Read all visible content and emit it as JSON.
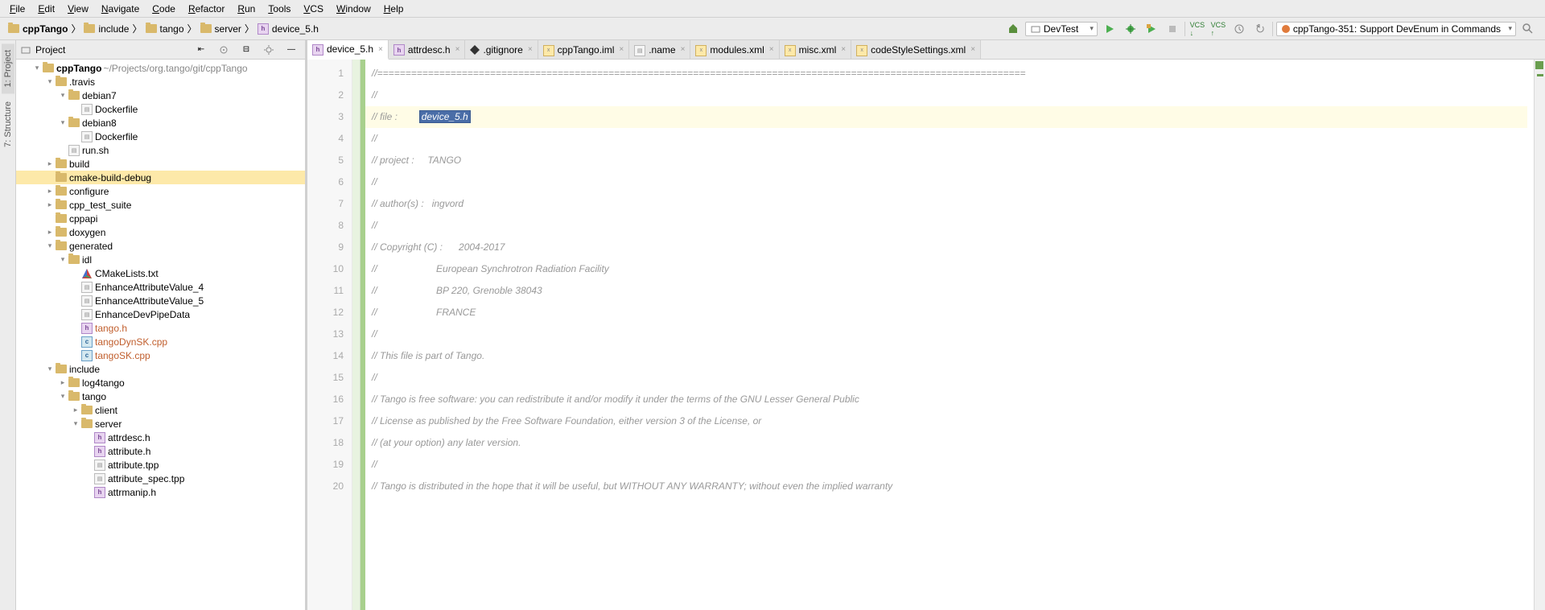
{
  "menu": [
    "File",
    "Edit",
    "View",
    "Navigate",
    "Code",
    "Refactor",
    "Run",
    "Tools",
    "VCS",
    "Window",
    "Help"
  ],
  "breadcrumbs": [
    {
      "icon": "folder",
      "label": "cppTango",
      "bold": true
    },
    {
      "icon": "folder",
      "label": "include"
    },
    {
      "icon": "folder",
      "label": "tango"
    },
    {
      "icon": "folder",
      "label": "server"
    },
    {
      "icon": "hfile",
      "label": "device_5.h"
    }
  ],
  "run_config": "DevTest",
  "task": "cppTango-351: Support DevEnum in Commands",
  "sidebar": {
    "title": "Project"
  },
  "tree": [
    {
      "d": 0,
      "a": "▾",
      "i": "folder",
      "t": "cppTango",
      "suffix": "  ~/Projects/org.tango/git/cppTango",
      "bold": true
    },
    {
      "d": 1,
      "a": "▾",
      "i": "folder",
      "t": ".travis"
    },
    {
      "d": 2,
      "a": "▾",
      "i": "folder",
      "t": "debian7"
    },
    {
      "d": 3,
      "a": "",
      "i": "file",
      "t": "Dockerfile"
    },
    {
      "d": 2,
      "a": "▾",
      "i": "folder",
      "t": "debian8"
    },
    {
      "d": 3,
      "a": "",
      "i": "file",
      "t": "Dockerfile"
    },
    {
      "d": 2,
      "a": "",
      "i": "file",
      "t": "run.sh"
    },
    {
      "d": 1,
      "a": "▸",
      "i": "folder",
      "t": "build"
    },
    {
      "d": 1,
      "a": "",
      "i": "folder",
      "t": "cmake-build-debug",
      "sel": true
    },
    {
      "d": 1,
      "a": "▸",
      "i": "folder",
      "t": "configure"
    },
    {
      "d": 1,
      "a": "▸",
      "i": "folder",
      "t": "cpp_test_suite"
    },
    {
      "d": 1,
      "a": "",
      "i": "folder",
      "t": "cppapi"
    },
    {
      "d": 1,
      "a": "▸",
      "i": "folder",
      "t": "doxygen"
    },
    {
      "d": 1,
      "a": "▾",
      "i": "folder",
      "t": "generated"
    },
    {
      "d": 2,
      "a": "▾",
      "i": "folder",
      "t": "idl"
    },
    {
      "d": 3,
      "a": "",
      "i": "cmake",
      "t": "CMakeLists.txt"
    },
    {
      "d": 3,
      "a": "",
      "i": "file",
      "t": "EnhanceAttributeValue_4"
    },
    {
      "d": 3,
      "a": "",
      "i": "file",
      "t": "EnhanceAttributeValue_5"
    },
    {
      "d": 3,
      "a": "",
      "i": "file",
      "t": "EnhanceDevPipeData"
    },
    {
      "d": 3,
      "a": "",
      "i": "hfile",
      "t": "tango.h",
      "orange": true
    },
    {
      "d": 3,
      "a": "",
      "i": "cpp",
      "t": "tangoDynSK.cpp",
      "orange": true
    },
    {
      "d": 3,
      "a": "",
      "i": "cpp",
      "t": "tangoSK.cpp",
      "orange": true
    },
    {
      "d": 1,
      "a": "▾",
      "i": "folder",
      "t": "include"
    },
    {
      "d": 2,
      "a": "▸",
      "i": "folder",
      "t": "log4tango"
    },
    {
      "d": 2,
      "a": "▾",
      "i": "folder",
      "t": "tango"
    },
    {
      "d": 3,
      "a": "▸",
      "i": "folder",
      "t": "client"
    },
    {
      "d": 3,
      "a": "▾",
      "i": "folder",
      "t": "server"
    },
    {
      "d": 4,
      "a": "",
      "i": "hfile",
      "t": "attrdesc.h"
    },
    {
      "d": 4,
      "a": "",
      "i": "hfile",
      "t": "attribute.h"
    },
    {
      "d": 4,
      "a": "",
      "i": "file",
      "t": "attribute.tpp"
    },
    {
      "d": 4,
      "a": "",
      "i": "file",
      "t": "attribute_spec.tpp"
    },
    {
      "d": 4,
      "a": "",
      "i": "hfile",
      "t": "attrmanip.h"
    }
  ],
  "tabs": [
    {
      "i": "hfile",
      "t": "device_5.h",
      "active": true
    },
    {
      "i": "hfile",
      "t": "attrdesc.h"
    },
    {
      "i": "git",
      "t": ".gitignore"
    },
    {
      "i": "iml",
      "t": "cppTango.iml"
    },
    {
      "i": "file",
      "t": ".name"
    },
    {
      "i": "xml",
      "t": "modules.xml"
    },
    {
      "i": "xml",
      "t": "misc.xml"
    },
    {
      "i": "xml",
      "t": "codeStyleSettings.xml"
    }
  ],
  "code": {
    "start": 1,
    "lines": [
      "//===================================================================================================================",
      "//",
      {
        "prefix": "// file :        ",
        "sel": "device_5.h",
        "hl": true
      },
      "//",
      "// project :     TANGO",
      "//",
      "// author(s) :   ingvord",
      "//",
      "// Copyright (C) :      2004-2017",
      "//                      European Synchrotron Radiation Facility",
      "//                      BP 220, Grenoble 38043",
      "//                      FRANCE",
      "//",
      "// This file is part of Tango.",
      "//",
      "// Tango is free software: you can redistribute it and/or modify it under the terms of the GNU Lesser General Public",
      "// License as published by the Free Software Foundation, either version 3 of the License, or",
      "// (at your option) any later version.",
      "//",
      "// Tango is distributed in the hope that it will be useful, but WITHOUT ANY WARRANTY; without even the implied warranty"
    ]
  }
}
